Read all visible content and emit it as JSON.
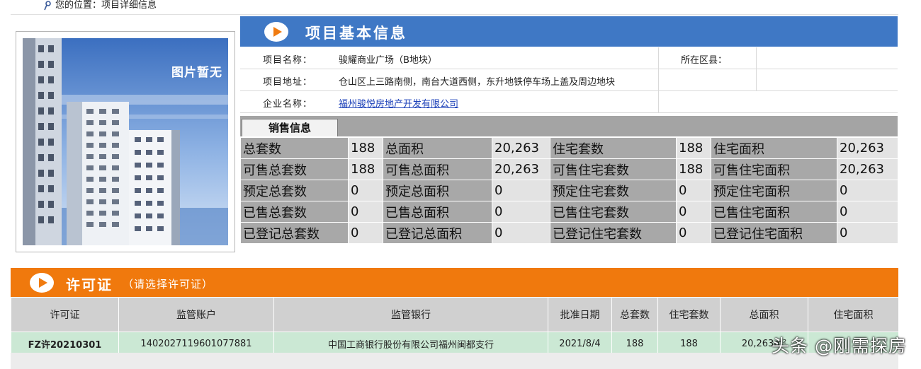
{
  "breadcrumb": {
    "prefix": "您的位置：",
    "current": "项目详细信息"
  },
  "photo": {
    "placeholder_text": "图片暂无"
  },
  "project_info": {
    "title": "项目基本信息",
    "name_label": "项目名称：",
    "name_value": "骏耀商业广场（B地块）",
    "district_label": "所在区县：",
    "district_value": "",
    "address_label": "项目地址：",
    "address_value": "仓山区上三路南侧，南台大道西侧，东升地铁停车场上盖及周边地块",
    "company_label": "企业名称：",
    "company_value": "福州骏悦房地产开发有限公司"
  },
  "sales": {
    "tab_label": "销售信息",
    "rows": [
      [
        {
          "k": "总套数",
          "v": "188"
        },
        {
          "k": "总面积",
          "v": "20,263"
        },
        {
          "k": "住宅套数",
          "v": "188"
        },
        {
          "k": "住宅面积",
          "v": "20,263"
        }
      ],
      [
        {
          "k": "可售总套数",
          "v": "188"
        },
        {
          "k": "可售总面积",
          "v": "20,263"
        },
        {
          "k": "可售住宅套数",
          "v": "188"
        },
        {
          "k": "可售住宅面积",
          "v": "20,263"
        }
      ],
      [
        {
          "k": "预定总套数",
          "v": "0"
        },
        {
          "k": "预定总面积",
          "v": "0"
        },
        {
          "k": "预定住宅套数",
          "v": "0"
        },
        {
          "k": "预定住宅面积",
          "v": "0"
        }
      ],
      [
        {
          "k": "已售总套数",
          "v": "0"
        },
        {
          "k": "已售总面积",
          "v": "0"
        },
        {
          "k": "已售住宅套数",
          "v": "0"
        },
        {
          "k": "已售住宅面积",
          "v": "0"
        }
      ],
      [
        {
          "k": "已登记总套数",
          "v": "0"
        },
        {
          "k": "已登记总面积",
          "v": "0"
        },
        {
          "k": "已登记住宅套数",
          "v": "0"
        },
        {
          "k": "已登记住宅面积",
          "v": "0"
        }
      ]
    ]
  },
  "permit": {
    "title": "许可证",
    "hint": "（请选择许可证）",
    "columns": [
      "许可证",
      "监管账户",
      "监管银行",
      "批准日期",
      "总套数",
      "住宅套数",
      "总面积",
      "住宅面积"
    ],
    "rows": [
      [
        "FZ许20210301",
        "1402027119601077881",
        "中国工商银行股份有限公司福州闽都支行",
        "2021/8/4",
        "188",
        "188",
        "20,263m²",
        ""
      ]
    ]
  },
  "watermark": "头条 @刚需探房",
  "colors": {
    "blue_header": "#3f78c5",
    "orange_header": "#f0790d",
    "label_gray": "#a8a8a8",
    "value_gray": "#e3e3e3",
    "permit_row": "#cbe8d4"
  }
}
